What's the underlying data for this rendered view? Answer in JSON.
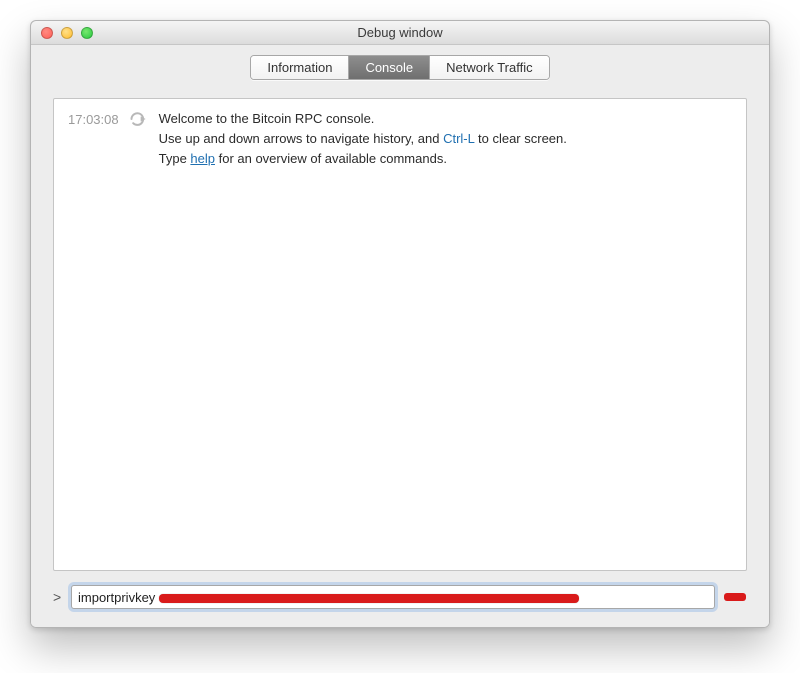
{
  "window": {
    "title": "Debug window"
  },
  "tabs": {
    "info": "Information",
    "console": "Console",
    "network": "Network Traffic"
  },
  "console": {
    "entry_time": "17:03:08",
    "welcome_line1": "Welcome to the Bitcoin RPC console.",
    "welcome_line2a": "Use up and down arrows to navigate history, and ",
    "welcome_line2_key": "Ctrl-L",
    "welcome_line2b": " to clear screen.",
    "welcome_line3a": "Type ",
    "welcome_help": "help",
    "welcome_line3b": " for an overview of available commands."
  },
  "input": {
    "prompt": ">",
    "command_prefix": "importprivkey "
  }
}
